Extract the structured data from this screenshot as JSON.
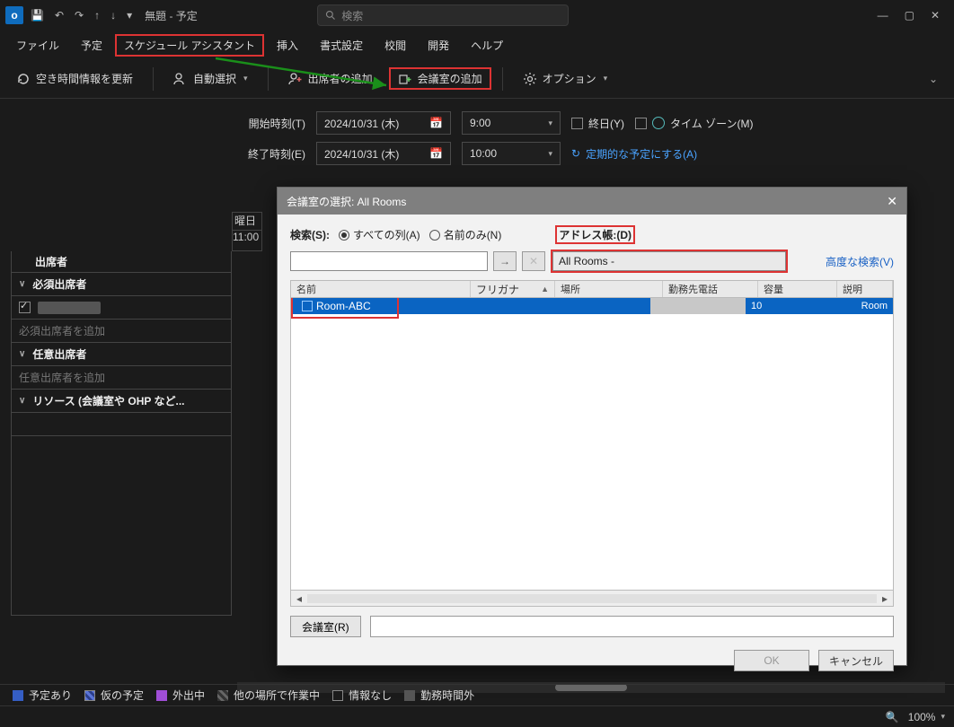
{
  "titlebar": {
    "app_letter": "o",
    "win_title": "無題 - 予定",
    "search_placeholder": "検索",
    "minimize": "—",
    "maximize": "▢",
    "close": "✕",
    "qat_save": "save-icon",
    "qat_undo": "undo-icon",
    "qat_redo": "redo-icon",
    "qat_up": "arrow-up-icon",
    "qat_down": "arrow-down-icon",
    "qat_more": "▾"
  },
  "menu": {
    "file": "ファイル",
    "appointment": "予定",
    "schedasst": "スケジュール アシスタント",
    "insert": "挿入",
    "format": "書式設定",
    "review": "校閲",
    "dev": "開発",
    "help": "ヘルプ"
  },
  "toolbar": {
    "refresh": "空き時間情報を更新",
    "autoselect": "自動選択",
    "add_attendee": "出席者の追加",
    "add_room": "会議室の追加",
    "options": "オプション"
  },
  "time": {
    "start_label": "開始時刻(T)",
    "end_label": "終了時刻(E)",
    "start_date": "2024/10/31 (木)",
    "end_date": "2024/10/31 (木)",
    "start_time": "9:00",
    "end_time": "10:00",
    "allday": "終日(Y)",
    "timezones": "タイム ゾーン(M)",
    "recurring": "定期的な予定にする(A)"
  },
  "grid": {
    "day_head": "曜日",
    "time_head": "11:00"
  },
  "attendees": {
    "header": "出席者",
    "required": "必須出席者",
    "required_ph": "必須出席者を追加",
    "optional": "任意出席者",
    "optional_ph": "任意出席者を追加",
    "resources": "リソース (会議室や OHP など..."
  },
  "dialog": {
    "title": "会議室の選択: All Rooms",
    "search_label": "検索(S):",
    "radio_all": "すべての列(A)",
    "radio_name": "名前のみ(N)",
    "addrbook_label": "アドレス帳:(D)",
    "addrbook_value": "All Rooms -",
    "go": "→",
    "clear": "✕",
    "advanced": "高度な検索(V)",
    "cols": {
      "name": "名前",
      "furigana": "フリガナ",
      "location": "場所",
      "phone": "勤務先電話",
      "capacity": "容量",
      "desc": "説明"
    },
    "row": {
      "name": "Room-ABC",
      "capacity": "10",
      "desc": "Room"
    },
    "room_btn": "会議室(R)",
    "ok": "OK",
    "cancel": "キャンセル"
  },
  "legend": {
    "busy": "予定あり",
    "tentative": "仮の予定",
    "oof": "外出中",
    "elsewhere": "他の場所で作業中",
    "noinfo": "情報なし",
    "offhours": "勤務時間外"
  },
  "status": {
    "zoom": "100%"
  }
}
